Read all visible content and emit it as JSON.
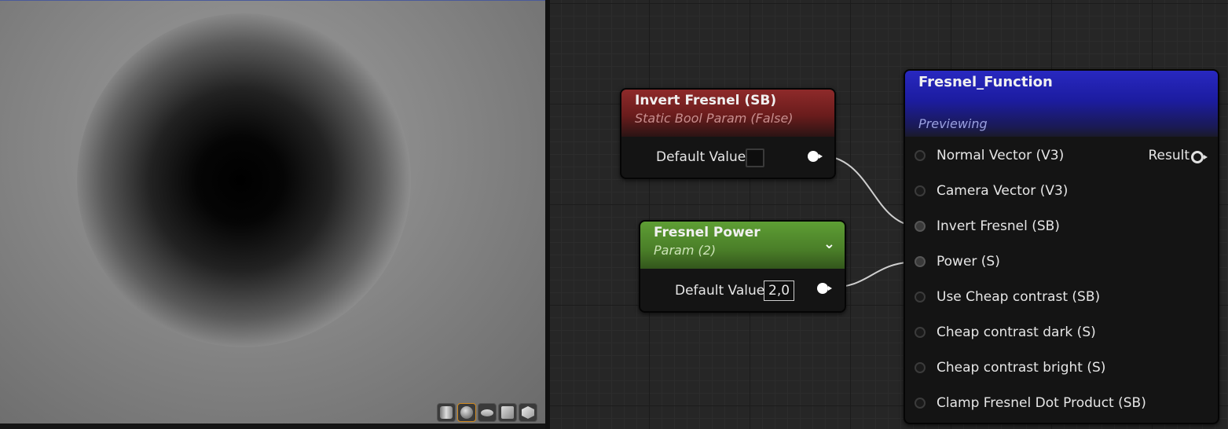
{
  "preview": {
    "toolbar": [
      {
        "name": "preview-cylinder",
        "icon": "cylinder-icon"
      },
      {
        "name": "preview-sphere",
        "icon": "sphere-icon"
      },
      {
        "name": "preview-plane",
        "icon": "plane-icon"
      },
      {
        "name": "preview-cube",
        "icon": "cube-icon"
      },
      {
        "name": "preview-custom-mesh",
        "icon": "teapot-icon"
      }
    ]
  },
  "graph": {
    "wire_color": "#cfcfcf",
    "nodes": {
      "invert": {
        "title": "Invert Fresnel (SB)",
        "subtitle": "Static Bool Param (False)",
        "field_label": "Default Value",
        "checked": false,
        "header_color": "#8e2a2a"
      },
      "power": {
        "title": "Fresnel Power",
        "subtitle": "Param (2)",
        "field_label": "Default Value",
        "value": "2,0",
        "header_color": "#5e9e34",
        "chevron": "⌄"
      },
      "fresnel": {
        "title": "Fresnel_Function",
        "subtitle": "Previewing",
        "header_color": "#2828c0",
        "output": "Result",
        "inputs": [
          "Normal Vector (V3)",
          "Camera Vector (V3)",
          "Invert Fresnel (SB)",
          "Power (S)",
          "Use Cheap contrast (SB)",
          "Cheap contrast dark (S)",
          "Cheap contrast bright (S)",
          "Clamp Fresnel Dot Product (SB)"
        ]
      }
    }
  }
}
